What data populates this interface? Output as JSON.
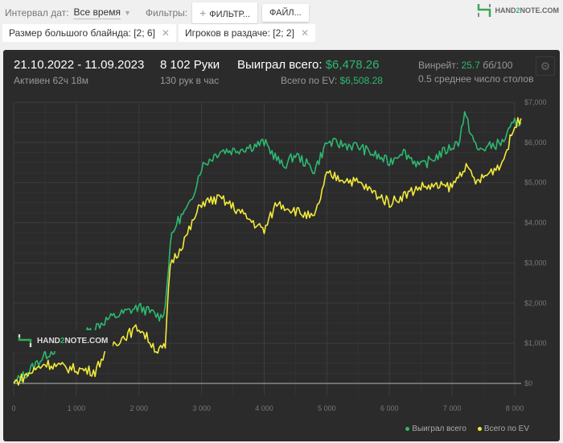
{
  "toolbar": {
    "date_label": "Интервал дат:",
    "date_value": "Все время",
    "filters_label": "Фильтры:",
    "filter_button": "ФИЛЬТР...",
    "file_button": "ФАЙЛ..."
  },
  "logo": {
    "text_a": "HAND",
    "text_b": "2",
    "text_c": "NOTE.COM"
  },
  "chips": [
    {
      "label": "Размер большого блайнда: [2; 6]"
    },
    {
      "label": "Игроков в раздаче: [2; 2]"
    }
  ],
  "summary": {
    "dates": "21.10.2022 - 11.09.2023",
    "active": "Активен 62ч 18м",
    "hands": "8 102 Руки",
    "hands_per_hour": "130 рук в час",
    "won_label": "Выиграл всего:",
    "won_value": "$6,478.26",
    "ev_label": "Всего по EV:",
    "ev_value": "$6,508.28",
    "winrate_label": "Винрейт:",
    "winrate_value": "25.7",
    "winrate_unit": "бб/100",
    "tables": "0.5 среднее число столов"
  },
  "colors": {
    "won": "#2db871",
    "ev": "#f2ea3a"
  },
  "chart_data": {
    "type": "line",
    "xlim": [
      0,
      8100
    ],
    "ylim": [
      0,
      7000
    ],
    "x_ticks": [
      "0",
      "1 000",
      "2 000",
      "3 000",
      "4 000",
      "5 000",
      "6 000",
      "7 000",
      "8 000"
    ],
    "y_ticks": [
      "$0",
      "$1,000",
      "$2,000",
      "$3,000",
      "$4,000",
      "$5,000",
      "$6,000",
      "$7,000"
    ],
    "legend": "bottom-right",
    "series": [
      {
        "name": "Выиграл всего",
        "x": [
          0,
          200,
          500,
          800,
          1000,
          1500,
          2000,
          2350,
          2420,
          2500,
          2600,
          2800,
          3000,
          3300,
          3500,
          3800,
          4000,
          4300,
          4500,
          4800,
          5000,
          5500,
          6000,
          6200,
          6500,
          7000,
          7100,
          7200,
          7400,
          7800,
          8000,
          8100
        ],
        "y": [
          0,
          250,
          700,
          1000,
          1100,
          1600,
          1900,
          1650,
          1900,
          3500,
          4000,
          4400,
          5400,
          5800,
          5800,
          5900,
          6000,
          5400,
          5700,
          5300,
          6000,
          5900,
          5500,
          5800,
          5400,
          5900,
          6000,
          6700,
          5800,
          6000,
          6500,
          6500
        ]
      },
      {
        "name": "Всего по EV",
        "x": [
          0,
          500,
          800,
          1300,
          1500,
          2000,
          2300,
          2420,
          2500,
          2600,
          2800,
          3000,
          3300,
          3500,
          4000,
          4200,
          4500,
          4800,
          5000,
          5500,
          6000,
          6500,
          7000,
          7200,
          7400,
          7800,
          8000,
          8100
        ],
        "y": [
          0,
          500,
          400,
          300,
          900,
          1400,
          800,
          900,
          3000,
          3200,
          3800,
          4500,
          4600,
          4400,
          3800,
          4500,
          4300,
          4100,
          5200,
          5000,
          4500,
          4900,
          4900,
          5400,
          5000,
          5500,
          6400,
          6600
        ]
      }
    ]
  }
}
